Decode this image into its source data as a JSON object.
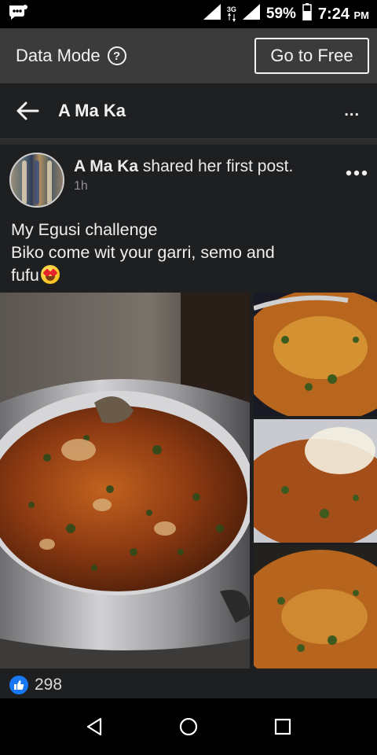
{
  "status_bar": {
    "network": "3G",
    "battery": "59%",
    "time": "7:24",
    "time_suffix": "PM"
  },
  "data_banner": {
    "label": "Data Mode",
    "help_icon": "question-circle-icon",
    "button_label": "Go to Free"
  },
  "header": {
    "title": "A Ma Ka",
    "more_label": "..."
  },
  "post": {
    "author": "A Ma Ka",
    "action": " shared her first post.",
    "time": "1h",
    "text_line1": "My Egusi challenge",
    "text_line2": "Biko come wit your garri, semo and",
    "text_line3": "fufu",
    "emoji": "heart-eyes-emoji",
    "like_count": "298"
  },
  "colors": {
    "like_blue": "#1877f2",
    "banner_bg": "#3b3b3c",
    "header_bg": "#1f2022"
  }
}
